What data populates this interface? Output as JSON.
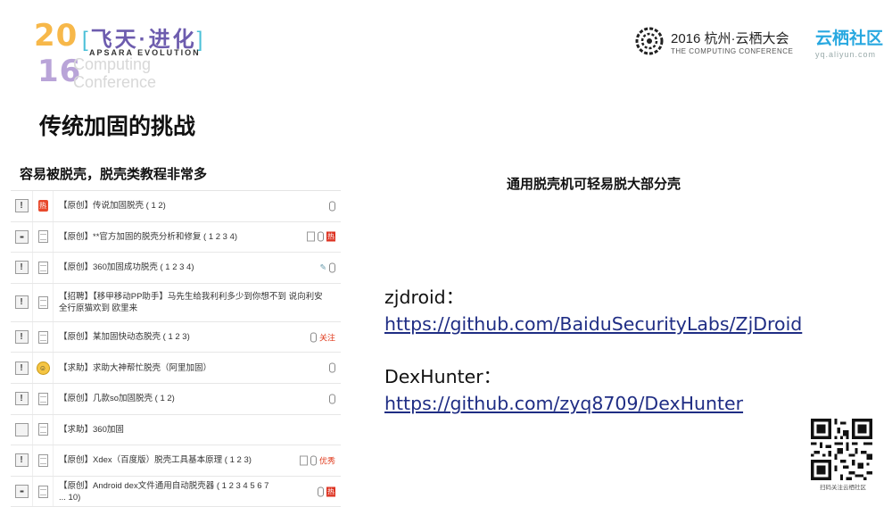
{
  "header": {
    "year_top": "20",
    "year_bottom": "16",
    "event_title": "飞天·进化",
    "event_sub": "APSARA EVOLUTION",
    "ghost_line1": "Computing",
    "ghost_line2": "Conference",
    "conference_main": "2016 杭州·云栖大会",
    "conference_sub": "THE COMPUTING CONFERENCE",
    "community_main": "云栖社区",
    "community_sub": "yq.aliyun.com"
  },
  "slide": {
    "title": "传统加固的挑战",
    "left_caption": "容易被脱壳，脱壳类教程非常多",
    "right_caption": "通用脱壳机可轻易脱大部分壳"
  },
  "forum_rows": [
    {
      "text": "【原创】传说加固脱壳 ( 1 2)"
    },
    {
      "text": "【原创】**官方加固的脱壳分析和修复 ( 1 2 3 4)",
      "badge": "热"
    },
    {
      "text": "【原创】360加固成功脱壳 ( 1 2 3 4)"
    },
    {
      "text": "【招聘】【移甲移动PP助手】马先生给我利利多少到你想不到 说向利安全行原猫欢到 欧里来"
    },
    {
      "text": "【原创】某加固快动态脱壳 ( 1 2 3)",
      "badge": "关注"
    },
    {
      "text": "【求助】求助大神帮忙脱壳（阿里加固）"
    },
    {
      "text": "【原创】几款so加固脱壳 ( 1 2)"
    },
    {
      "text": "【求助】360加固"
    },
    {
      "text": "【原创】Xdex（百度版）脱壳工具基本原理 ( 1 2 3)",
      "badge": "优秀"
    },
    {
      "text": "【原创】Android dex文件通用自动脱壳器 ( 1 2 3 4 5 6 7 ... 10)",
      "badge": "热"
    }
  ],
  "links": {
    "zjdroid_label": "zjdroid：",
    "zjdroid_url": "https://github.com/BaiduSecurityLabs/ZjDroid",
    "dexhunter_label": "DexHunter：",
    "dexhunter_url": "https://github.com/zyq8709/DexHunter"
  },
  "qr_caption": "扫码关注云栖社区",
  "colors": {
    "link": "#1f2d84",
    "community_blue": "#28a8e0",
    "year_orange": "#f7b84a",
    "year_purple": "#b9a4d8",
    "badge_red": "#d32222"
  }
}
